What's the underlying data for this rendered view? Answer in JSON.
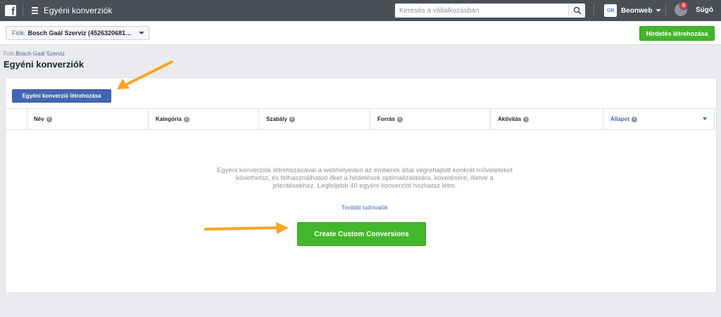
{
  "topbar": {
    "app_title": "Egyéni konverziók",
    "search_placeholder": "Keresés a vállalkozásban",
    "business_avatar": "GB",
    "business_name": "Beonweb",
    "notification_count": "5",
    "help_label": "Súgó"
  },
  "subbar": {
    "account_label": "Fiók:",
    "account_value": "Bosch Gaál Szerviz (4526320681…",
    "create_ad_label": "Hirdetés létrehozása"
  },
  "header": {
    "breadcrumb_label": "Fiók:",
    "breadcrumb_link": "Bosch Gaál Szerviz",
    "title": "Egyéni konverziók"
  },
  "panel": {
    "create_button": "Egyéni konverzió létrehozása",
    "columns": [
      "Név",
      "Kategória",
      "Szabály",
      "Forrás",
      "Aktivitás",
      "Állapot"
    ],
    "empty_text": "Egyéni konverziók létrehozásával a webhelyeden az emberek által végrehajtott konkrét műveleteket követhetsz, és felhasználhatod őket a hirdetések optimalizálására, követésére, illetve a jelentésekhez. Legfeljebb 40 egyéni konverziót hozhatsz létre.",
    "learn_more": "További tudnivalók",
    "cta_button": "Create Custom Conversions"
  },
  "colors": {
    "topbar": "#4b4f56",
    "primary_blue": "#4267b2",
    "green": "#42b72a",
    "arrow": "#f5a623"
  }
}
